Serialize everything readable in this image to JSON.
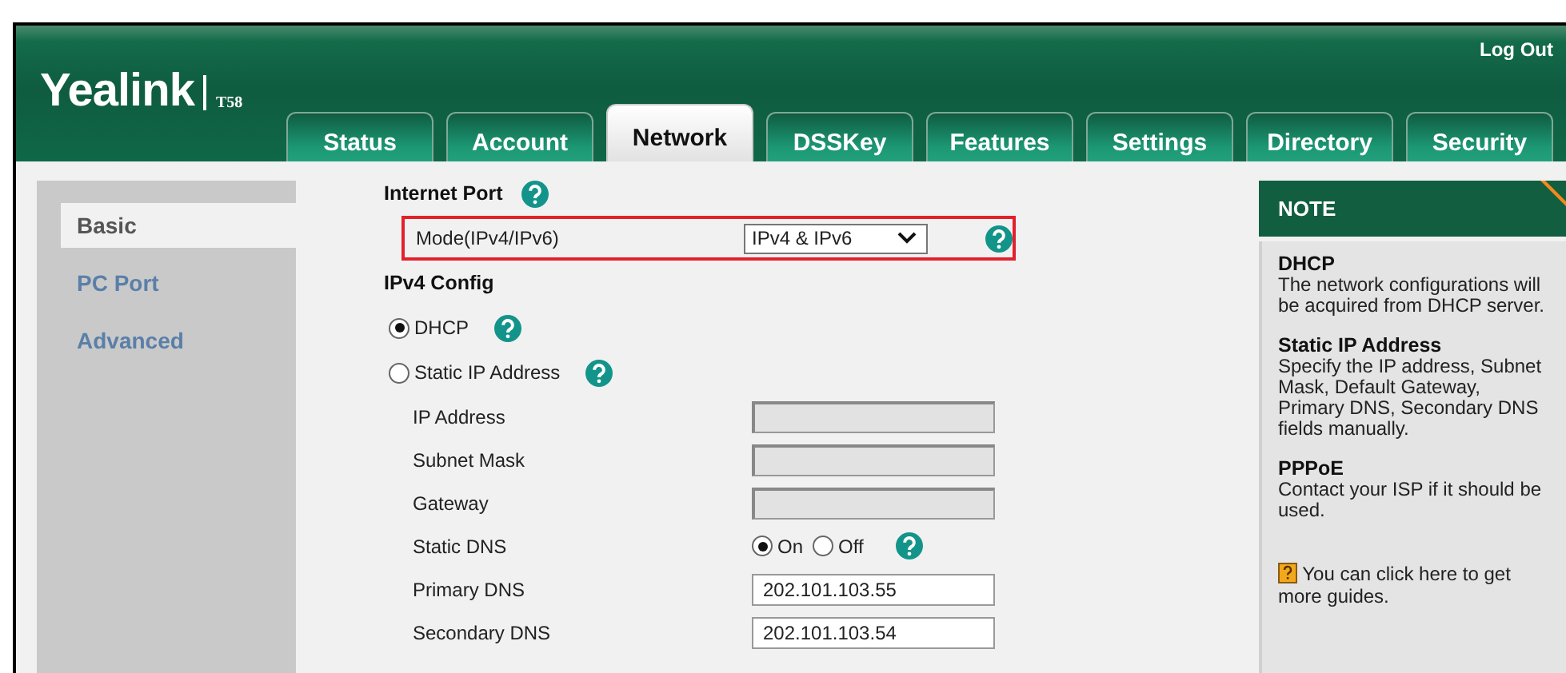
{
  "header": {
    "logo": "Yealink",
    "model": "T58",
    "logout": "Log Out"
  },
  "tabs": [
    {
      "label": "Status",
      "selected": false
    },
    {
      "label": "Account",
      "selected": false
    },
    {
      "label": "Network",
      "selected": true
    },
    {
      "label": "DSSKey",
      "selected": false
    },
    {
      "label": "Features",
      "selected": false
    },
    {
      "label": "Settings",
      "selected": false
    },
    {
      "label": "Directory",
      "selected": false
    },
    {
      "label": "Security",
      "selected": false
    }
  ],
  "sidebar": {
    "items": [
      {
        "label": "Basic",
        "selected": true
      },
      {
        "label": "PC Port",
        "selected": false
      },
      {
        "label": "Advanced",
        "selected": false
      }
    ]
  },
  "form": {
    "rows": [
      {
        "kind": "heading",
        "label": "Internet Port",
        "help": true
      },
      {
        "kind": "select",
        "label": "Mode(IPv4/IPv6)",
        "value": "IPv4 & IPv6",
        "help": true,
        "highlighted": true
      },
      {
        "kind": "heading",
        "label": "IPv4 Config"
      },
      {
        "kind": "radio",
        "label": "DHCP",
        "checked": true,
        "help": true
      },
      {
        "kind": "radio",
        "label": "Static IP Address",
        "checked": false,
        "help": true
      },
      {
        "kind": "field",
        "label": "IP Address",
        "disabled": true
      },
      {
        "kind": "field",
        "label": "Subnet Mask",
        "disabled": true
      },
      {
        "kind": "field",
        "label": "Gateway",
        "disabled": true
      },
      {
        "kind": "toggle",
        "label": "Static DNS",
        "options": [
          {
            "label": "On",
            "selected": true
          },
          {
            "label": "Off",
            "selected": false
          }
        ],
        "help": true
      },
      {
        "kind": "field",
        "label": "Primary DNS",
        "value": "202.101.103.55",
        "disabled": false
      },
      {
        "kind": "field",
        "label": "Secondary DNS",
        "value": "202.101.103.54",
        "disabled": false
      }
    ]
  },
  "note": {
    "title": "NOTE",
    "entries": [
      {
        "heading": "DHCP",
        "text": "The network configurations will be acquired from DHCP server."
      },
      {
        "heading": "Static IP Address",
        "text": "Specify the IP address, Subnet Mask, Default Gateway, Primary DNS, Secondary DNS fields manually."
      },
      {
        "heading": "PPPoE",
        "text": "Contact your ISP if it should be used."
      }
    ],
    "guide": "You can click here to get more guides."
  }
}
